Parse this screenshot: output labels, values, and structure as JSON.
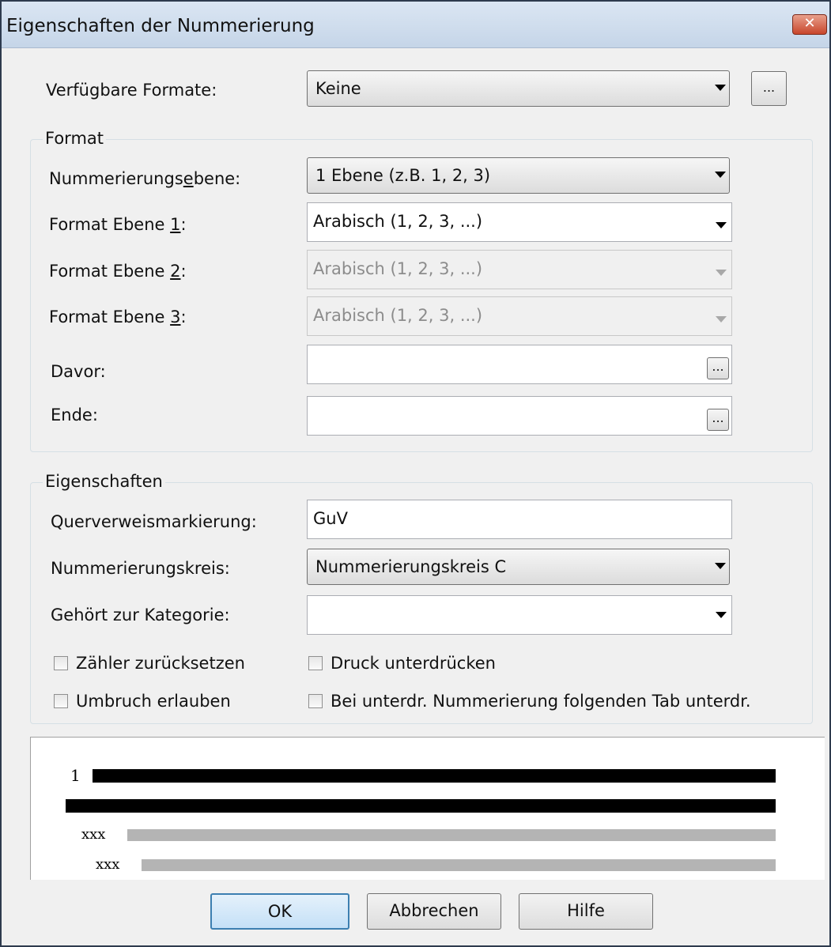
{
  "window": {
    "title": "Eigenschaften der Nummerierung",
    "close_glyph": "✕"
  },
  "available_formats": {
    "label": "Verfügbare Formate:",
    "value": "Keine",
    "more_button": "..."
  },
  "format_group": {
    "title": "Format",
    "level_label_pre": "Nummerierungs",
    "level_label_u": "e",
    "level_label_post": "bene:",
    "level_value": "1 Ebene (z.B. 1, 2, 3)",
    "level1_label_pre": "Format Ebene ",
    "level1_label_u": "1",
    "level1_label_post": ":",
    "level1_value": "Arabisch (1, 2, 3, ...)",
    "level2_label_pre": "Format Ebene ",
    "level2_label_u": "2",
    "level2_label_post": ":",
    "level2_value": "Arabisch (1, 2, 3, ...)",
    "level3_label_pre": "Format Ebene ",
    "level3_label_u": "3",
    "level3_label_post": ":",
    "level3_value": "Arabisch (1, 2, 3, ...)",
    "before_label": "Davor:",
    "before_value": "",
    "end_label": "Ende:",
    "end_value": "",
    "more_button": "..."
  },
  "properties_group": {
    "title": "Eigenschaften",
    "crossref_label": "Querverweismarkierung:",
    "crossref_value": "GuV",
    "circle_label": "Nummerierungskreis:",
    "circle_value": "Nummerierungskreis C",
    "category_label": "Gehört zur Kategorie:",
    "category_value": "",
    "reset_counter": {
      "label": "Zähler zurücksetzen",
      "checked": false
    },
    "suppress_print": {
      "label": "Druck unterdrücken",
      "checked": false
    },
    "allow_break": {
      "label": "Umbruch erlauben",
      "checked": false
    },
    "suppress_tab": {
      "label": "Bei unterdr. Nummerierung folgenden Tab unterdr.",
      "checked": false
    }
  },
  "preview": {
    "number": "1",
    "sub_marker_1": "xxx",
    "sub_marker_2": "xxx"
  },
  "buttons": {
    "ok": "OK",
    "cancel": "Abbrechen",
    "help": "Hilfe"
  }
}
